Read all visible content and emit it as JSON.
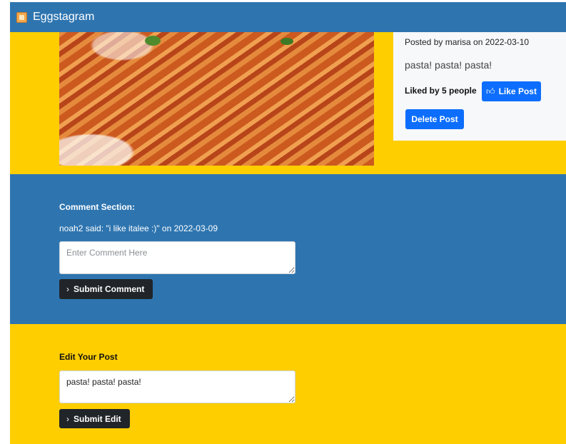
{
  "navbar": {
    "brand": "Eggstagram",
    "logo_icon": "egg-logo-icon",
    "background": "#2e75b0"
  },
  "post": {
    "meta": "Posted by marisa on 2022-03-10",
    "caption": "pasta! pasta! pasta!",
    "likes_text": "Liked by 5 people",
    "like_button": "Like Post",
    "like_icon": "thumbs-up-icon",
    "delete_button": "Delete Post",
    "accent": "#0d6efd"
  },
  "comments": {
    "title": "Comment Section:",
    "items": [
      {
        "text": "noah2 said: \"i like italee :)\" on 2022-03-09"
      }
    ],
    "input_placeholder": "Enter Comment Here",
    "submit_button": "Submit Comment",
    "submit_icon": "chevron-right-icon"
  },
  "edit": {
    "title": "Edit Your Post",
    "input_value": "pasta! pasta! pasta!",
    "submit_button": "Submit Edit",
    "submit_icon": "chevron-right-icon"
  },
  "colors": {
    "yellow_section": "#ffce00",
    "blue_section": "#2e75b0",
    "dark_button": "#212529"
  }
}
